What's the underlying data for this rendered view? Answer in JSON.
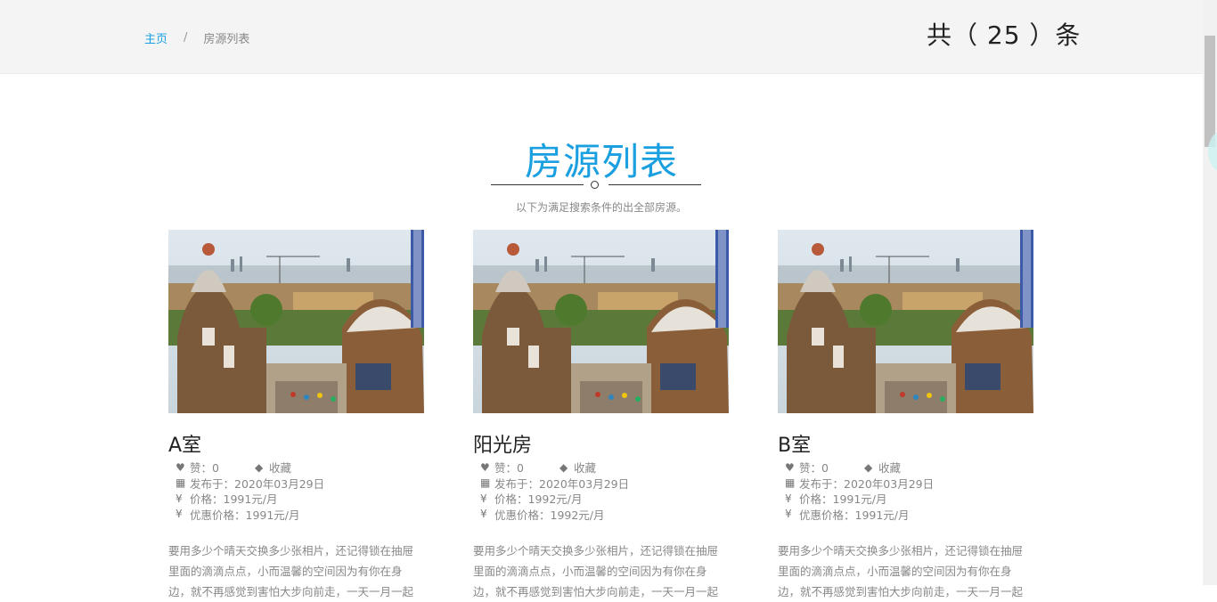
{
  "breadcrumb": {
    "home": "主页",
    "separator": "/",
    "current": "房源列表"
  },
  "total": "共（ 25 ）条",
  "section": {
    "title": "房源列表",
    "subtitle": "以下为满足搜索条件的出全部房源。"
  },
  "cards": [
    {
      "title": "A室",
      "likes": "赞：0",
      "favorite": "收藏",
      "published": "发布于：2020年03月29日",
      "price": "价格：1991元/月",
      "discount": "优惠价格：1991元/月",
      "desc": "要用多少个晴天交换多少张相片，还记得锁在抽屉里面的滴滴点点，小而温馨的空间因为有你在身边，就不再感觉到害怕大步向前走，一天一月一起"
    },
    {
      "title": "阳光房",
      "likes": "赞：0",
      "favorite": "收藏",
      "published": "发布于：2020年03月29日",
      "price": "价格：1992元/月",
      "discount": "优惠价格：1992元/月",
      "desc": "要用多少个晴天交换多少张相片，还记得锁在抽屉里面的滴滴点点，小而温馨的空间因为有你在身边，就不再感觉到害怕大步向前走，一天一月一起"
    },
    {
      "title": "B室",
      "likes": "赞：0",
      "favorite": "收藏",
      "published": "发布于：2020年03月29日",
      "price": "价格：1991元/月",
      "discount": "优惠价格：1991元/月",
      "desc": "要用多少个晴天交换多少张相片，还记得锁在抽屉里面的滴滴点点，小而温馨的空间因为有你在身边，就不再感觉到害怕大步向前走，一天一月一起"
    }
  ],
  "icons": {
    "like": "heart-icon",
    "favorite": "tag-icon",
    "date": "calendar-icon",
    "price": "yen-icon"
  },
  "colors": {
    "accent": "#1aa0e0",
    "topbar": "#f4f4f4",
    "text_muted": "#888888"
  }
}
